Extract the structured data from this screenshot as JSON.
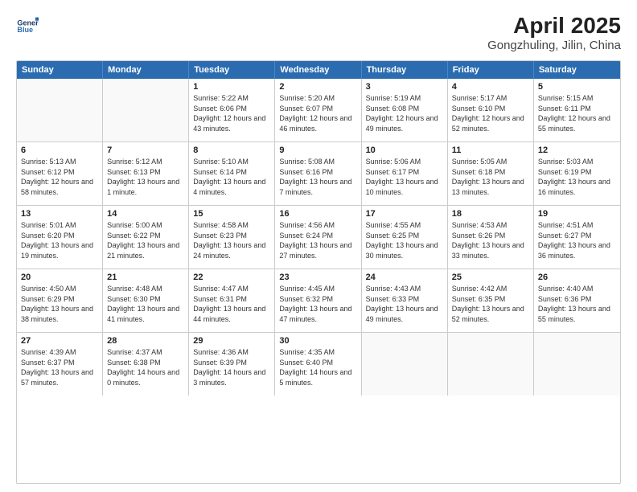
{
  "header": {
    "logo_line1": "General",
    "logo_line2": "Blue",
    "title": "April 2025",
    "subtitle": "Gongzhuling, Jilin, China"
  },
  "calendar": {
    "days_of_week": [
      "Sunday",
      "Monday",
      "Tuesday",
      "Wednesday",
      "Thursday",
      "Friday",
      "Saturday"
    ],
    "weeks": [
      [
        {
          "day": "",
          "info": ""
        },
        {
          "day": "",
          "info": ""
        },
        {
          "day": "1",
          "info": "Sunrise: 5:22 AM\nSunset: 6:06 PM\nDaylight: 12 hours\nand 43 minutes."
        },
        {
          "day": "2",
          "info": "Sunrise: 5:20 AM\nSunset: 6:07 PM\nDaylight: 12 hours\nand 46 minutes."
        },
        {
          "day": "3",
          "info": "Sunrise: 5:19 AM\nSunset: 6:08 PM\nDaylight: 12 hours\nand 49 minutes."
        },
        {
          "day": "4",
          "info": "Sunrise: 5:17 AM\nSunset: 6:10 PM\nDaylight: 12 hours\nand 52 minutes."
        },
        {
          "day": "5",
          "info": "Sunrise: 5:15 AM\nSunset: 6:11 PM\nDaylight: 12 hours\nand 55 minutes."
        }
      ],
      [
        {
          "day": "6",
          "info": "Sunrise: 5:13 AM\nSunset: 6:12 PM\nDaylight: 12 hours\nand 58 minutes."
        },
        {
          "day": "7",
          "info": "Sunrise: 5:12 AM\nSunset: 6:13 PM\nDaylight: 13 hours\nand 1 minute."
        },
        {
          "day": "8",
          "info": "Sunrise: 5:10 AM\nSunset: 6:14 PM\nDaylight: 13 hours\nand 4 minutes."
        },
        {
          "day": "9",
          "info": "Sunrise: 5:08 AM\nSunset: 6:16 PM\nDaylight: 13 hours\nand 7 minutes."
        },
        {
          "day": "10",
          "info": "Sunrise: 5:06 AM\nSunset: 6:17 PM\nDaylight: 13 hours\nand 10 minutes."
        },
        {
          "day": "11",
          "info": "Sunrise: 5:05 AM\nSunset: 6:18 PM\nDaylight: 13 hours\nand 13 minutes."
        },
        {
          "day": "12",
          "info": "Sunrise: 5:03 AM\nSunset: 6:19 PM\nDaylight: 13 hours\nand 16 minutes."
        }
      ],
      [
        {
          "day": "13",
          "info": "Sunrise: 5:01 AM\nSunset: 6:20 PM\nDaylight: 13 hours\nand 19 minutes."
        },
        {
          "day": "14",
          "info": "Sunrise: 5:00 AM\nSunset: 6:22 PM\nDaylight: 13 hours\nand 21 minutes."
        },
        {
          "day": "15",
          "info": "Sunrise: 4:58 AM\nSunset: 6:23 PM\nDaylight: 13 hours\nand 24 minutes."
        },
        {
          "day": "16",
          "info": "Sunrise: 4:56 AM\nSunset: 6:24 PM\nDaylight: 13 hours\nand 27 minutes."
        },
        {
          "day": "17",
          "info": "Sunrise: 4:55 AM\nSunset: 6:25 PM\nDaylight: 13 hours\nand 30 minutes."
        },
        {
          "day": "18",
          "info": "Sunrise: 4:53 AM\nSunset: 6:26 PM\nDaylight: 13 hours\nand 33 minutes."
        },
        {
          "day": "19",
          "info": "Sunrise: 4:51 AM\nSunset: 6:27 PM\nDaylight: 13 hours\nand 36 minutes."
        }
      ],
      [
        {
          "day": "20",
          "info": "Sunrise: 4:50 AM\nSunset: 6:29 PM\nDaylight: 13 hours\nand 38 minutes."
        },
        {
          "day": "21",
          "info": "Sunrise: 4:48 AM\nSunset: 6:30 PM\nDaylight: 13 hours\nand 41 minutes."
        },
        {
          "day": "22",
          "info": "Sunrise: 4:47 AM\nSunset: 6:31 PM\nDaylight: 13 hours\nand 44 minutes."
        },
        {
          "day": "23",
          "info": "Sunrise: 4:45 AM\nSunset: 6:32 PM\nDaylight: 13 hours\nand 47 minutes."
        },
        {
          "day": "24",
          "info": "Sunrise: 4:43 AM\nSunset: 6:33 PM\nDaylight: 13 hours\nand 49 minutes."
        },
        {
          "day": "25",
          "info": "Sunrise: 4:42 AM\nSunset: 6:35 PM\nDaylight: 13 hours\nand 52 minutes."
        },
        {
          "day": "26",
          "info": "Sunrise: 4:40 AM\nSunset: 6:36 PM\nDaylight: 13 hours\nand 55 minutes."
        }
      ],
      [
        {
          "day": "27",
          "info": "Sunrise: 4:39 AM\nSunset: 6:37 PM\nDaylight: 13 hours\nand 57 minutes."
        },
        {
          "day": "28",
          "info": "Sunrise: 4:37 AM\nSunset: 6:38 PM\nDaylight: 14 hours\nand 0 minutes."
        },
        {
          "day": "29",
          "info": "Sunrise: 4:36 AM\nSunset: 6:39 PM\nDaylight: 14 hours\nand 3 minutes."
        },
        {
          "day": "30",
          "info": "Sunrise: 4:35 AM\nSunset: 6:40 PM\nDaylight: 14 hours\nand 5 minutes."
        },
        {
          "day": "",
          "info": ""
        },
        {
          "day": "",
          "info": ""
        },
        {
          "day": "",
          "info": ""
        }
      ]
    ]
  }
}
